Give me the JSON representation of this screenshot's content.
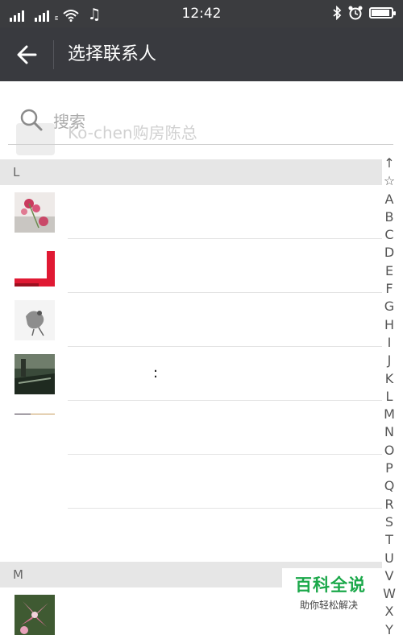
{
  "status_bar": {
    "time": "12:42",
    "signal1_label": "",
    "signal2_label": "E",
    "icons": [
      "signal-icon",
      "signal-icon",
      "wifi-icon",
      "music-icon",
      "bluetooth-icon",
      "alarm-icon",
      "battery-icon"
    ]
  },
  "header": {
    "title": "选择联系人",
    "back_icon": "arrow-left-icon"
  },
  "search": {
    "placeholder": "搜索",
    "ghost_contact_name": "Ko-chen购房陈总"
  },
  "sections": [
    {
      "label": "L"
    },
    {
      "label": "M"
    }
  ],
  "contacts_L": [
    {
      "name": "",
      "avatar": "pink-flowers"
    },
    {
      "name": "",
      "avatar": "red-frame"
    },
    {
      "name": "",
      "avatar": "bird-sketch"
    },
    {
      "name": ":",
      "avatar": "city-street"
    },
    {
      "name": "",
      "avatar": "sunset-strip"
    },
    {
      "name": "",
      "avatar": "none"
    },
    {
      "name": "",
      "avatar": "none"
    }
  ],
  "contacts_M": [
    {
      "name": "",
      "avatar": "lily-flowers"
    }
  ],
  "index_bar": [
    "↑",
    "☆",
    "A",
    "B",
    "C",
    "D",
    "E",
    "F",
    "G",
    "H",
    "I",
    "J",
    "K",
    "L",
    "M",
    "N",
    "O",
    "P",
    "Q",
    "R",
    "S",
    "T",
    "U",
    "V",
    "W",
    "X",
    "Y"
  ],
  "watermark": {
    "title": "百科全说",
    "subtitle": "助你轻松解决"
  },
  "colors": {
    "title_bar": "#393a3f",
    "status_bar": "#3b3c3f",
    "section_header": "#e6e6e6",
    "watermark_green": "#1ba84a"
  }
}
